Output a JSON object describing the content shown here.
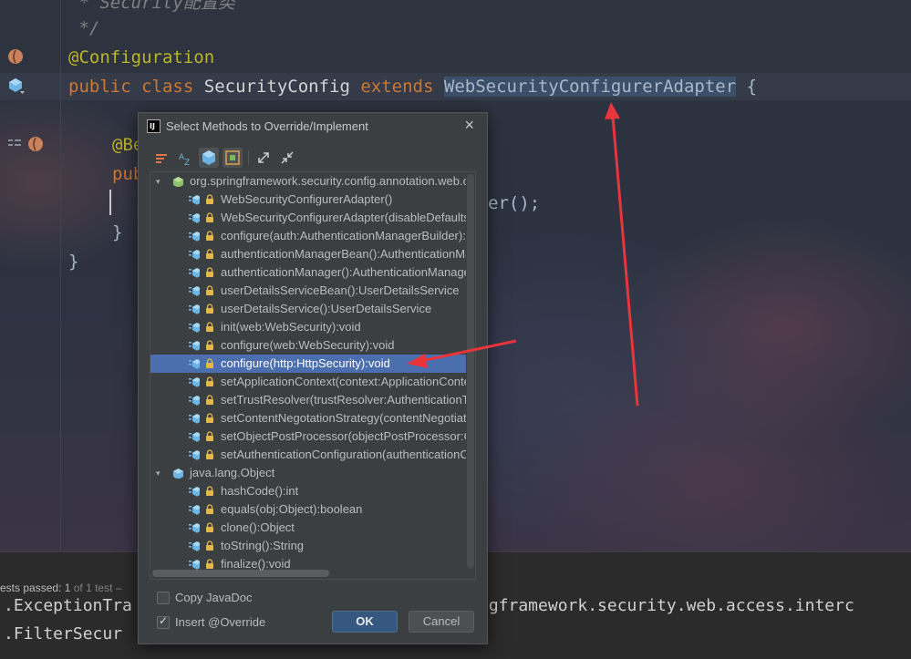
{
  "editor": {
    "lines": [
      {
        "text": " * Security配置类"
      },
      {
        "text": " */"
      },
      {
        "annotation": "@Configuration"
      },
      {
        "kw1": "public",
        "kw2": "class",
        "name": "SecurityConfig",
        "kw3": "extends",
        "super": "WebSecurityConfigurerAdapter",
        "brace": "{"
      },
      {
        "annotation": "@Be"
      },
      {
        "kw1": "pub"
      },
      {
        "tail": "er();"
      },
      {
        "close": "}"
      },
      {
        "close": "}"
      }
    ]
  },
  "run_panel": {
    "status_prefix": "ests passed: ",
    "status_count": "1",
    "status_suffix": " of 1 test – ",
    "console": [
      ".ExceptionTra",
      "ngframework.security.web.access.interc",
      ".FilterSecur"
    ]
  },
  "dialog": {
    "logo": "IJ",
    "title": "Select Methods to Override/Implement",
    "close": "×",
    "toolbar": [
      "sort-icon",
      "sort-alpha-icon",
      "class-icon",
      "filter-icon",
      "expand-all-icon",
      "collapse-all-icon"
    ],
    "groups": [
      {
        "label": "org.springframework.security.config.annotation.web.co",
        "methods": [
          "WebSecurityConfigurerAdapter()",
          "WebSecurityConfigurerAdapter(disableDefaults:b",
          "configure(auth:AuthenticationManagerBuilder):vc",
          "authenticationManagerBean():AuthenticationMan",
          "authenticationManager():AuthenticationManager",
          "userDetailsServiceBean():UserDetailsService",
          "userDetailsService():UserDetailsService",
          "init(web:WebSecurity):void",
          "configure(web:WebSecurity):void",
          "configure(http:HttpSecurity):void",
          "setApplicationContext(context:ApplicationContex",
          "setTrustResolver(trustResolver:AuthenticationTru",
          "setContentNegotationStrategy(contentNegotiatic",
          "setObjectPostProcessor(objectPostProcessor:Ob",
          "setAuthenticationConfiguration(authenticationCo"
        ]
      },
      {
        "label": "java.lang.Object",
        "methods": [
          "hashCode():int",
          "equals(obj:Object):boolean",
          "clone():Object",
          "toString():String",
          "finalize():void"
        ]
      }
    ],
    "selected_index": 9,
    "options": {
      "copy_javadoc": {
        "label": "Copy JavaDoc",
        "checked": false
      },
      "insert_override": {
        "label": "Insert @Override",
        "checked": true
      }
    },
    "ok_label": "OK",
    "cancel_label": "Cancel"
  },
  "colors": {
    "selection": "#4b6eaf",
    "arrow": "#e8343a",
    "keyword": "#cc7832",
    "annotation": "#bbb529"
  }
}
